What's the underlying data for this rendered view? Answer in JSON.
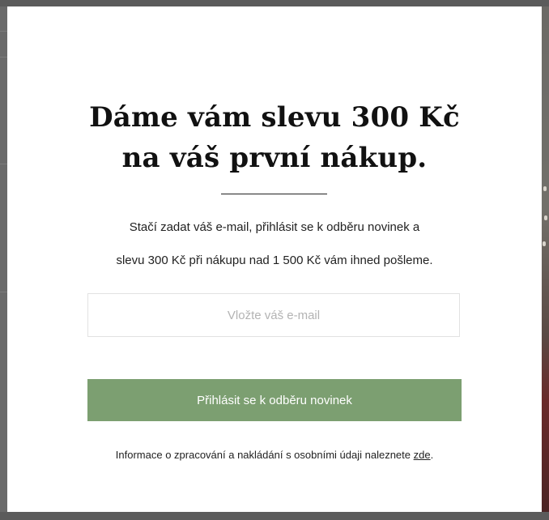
{
  "modal": {
    "headline_line1": "Dáme vám slevu 300 Kč",
    "headline_line2": "na váš první nákup.",
    "description_line1": "Stačí zadat váš e-mail, přihlásit se k odběru novinek a",
    "description_line2": "slevu 300 Kč při nákupu nad 1 500 Kč vám ihned pošleme.",
    "email_placeholder": "Vložte váš e-mail",
    "email_value": "",
    "subscribe_label": "Přihlásit se k odběru novinek",
    "privacy_text": "Informace o zpracování a nakládání s osobními údaji naleznete ",
    "privacy_link_label": "zde",
    "privacy_suffix": "."
  },
  "colors": {
    "overlay": "#5b5b5b",
    "modal_background": "#ffffff",
    "button_background": "#7c9f71",
    "button_text": "#ffffff",
    "input_border": "#e2e2e2",
    "placeholder": "#b3b3b3",
    "text": "#222222"
  }
}
